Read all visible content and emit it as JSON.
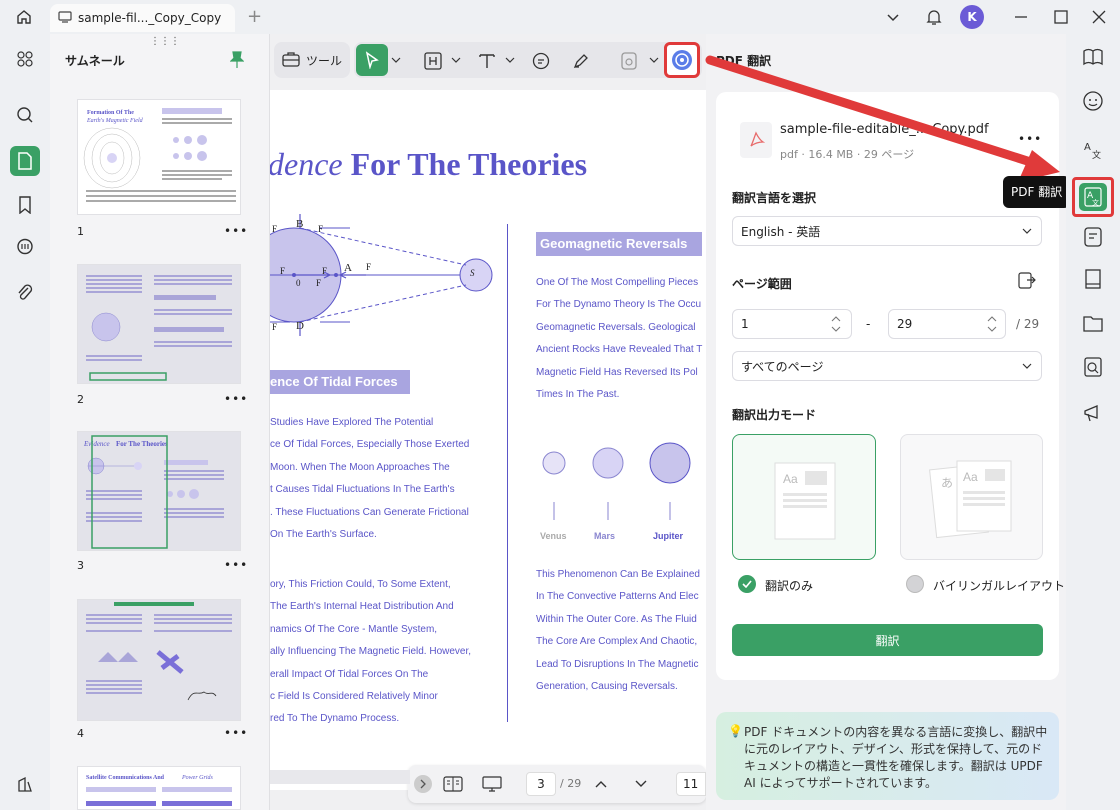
{
  "titlebar": {
    "tab_title": "sample-fil..._Copy_Copy",
    "new_tab": "+",
    "avatar_letter": "K"
  },
  "thumbnails": {
    "title": "サムネール",
    "pages": [
      {
        "num": "1"
      },
      {
        "num": "2"
      },
      {
        "num": "3"
      },
      {
        "num": "4"
      }
    ],
    "more": "•••",
    "thumb1_title_a": "Formation Of The",
    "thumb1_title_b": "Earth's Magnetic Field",
    "thumb3_title_a": "Evidence",
    "thumb3_title_b": "For The Theories",
    "thumb5_title_a": "Satellite Communications And",
    "thumb5_title_b": "Power Grids"
  },
  "toolbar": {
    "tools_label": "ツール"
  },
  "document": {
    "heading_italic": "dence",
    "heading_bold": "For The Theories",
    "section_tidal": "ence Of Tidal Forces",
    "section_geomag": "Geomagnetic Reversals",
    "diagram_labels": {
      "b": "B",
      "d": "D",
      "a": "A",
      "o": "0",
      "ff1": "F",
      "ff2": "F",
      "fg1": "F",
      "fg2": "F",
      "fg3": "F",
      "fc": "F",
      "fr": "F",
      "s": "S"
    },
    "left_para1": [
      "Studies Have Explored The Potential",
      "ce Of Tidal Forces, Especially Those Exerted",
      "Moon. When The Moon Approaches The",
      "t Causes Tidal Fluctuations In The Earth's",
      ". These Fluctuations Can Generate Frictional",
      "On The Earth's Surface."
    ],
    "left_para2": [
      "ory, This Friction Could, To Some Extent,",
      "The Earth's Internal Heat Distribution And",
      "namics Of The Core - Mantle System,",
      "ally Influencing The Magnetic Field. However,",
      "erall Impact Of Tidal Forces On The",
      "c Field Is Considered Relatively Minor",
      "red To The Dynamo Process."
    ],
    "right_para1": [
      "One Of The Most Compelling Pieces",
      "For The Dynamo Theory Is The Occu",
      "Geomagnetic Reversals. Geological",
      "Ancient Rocks Have Revealed That T",
      "Magnetic Field Has Reversed Its Pol",
      "Times In The Past."
    ],
    "planets": [
      "Venus",
      "Mars",
      "Jupiter"
    ],
    "right_para2": [
      "This Phenomenon Can Be Explained",
      "In The Convective Patterns And Elec",
      "Within The Outer Core. As The Fluid",
      "The Core Are Complex And Chaotic,",
      "Lead To Disruptions In The Magnetic",
      "Generation, Causing Reversals."
    ]
  },
  "bottomnav": {
    "current_page": "3",
    "total": "/ 29",
    "zoom": "11"
  },
  "translate_panel": {
    "title": "PDF 翻訳",
    "file_name": "sample-file-editable_... Copy.pdf",
    "file_meta": "pdf · 16.4 MB · 29 ページ",
    "more": "•••",
    "lang_label": "翻訳言語を選択",
    "lang_value": "English - 英語",
    "range_label": "ページ範囲",
    "range_from": "1",
    "range_dash": "-",
    "range_to": "29",
    "range_total": "/ 29",
    "pages_value": "すべてのページ",
    "mode_label": "翻訳出力モード",
    "mode_translate_only": "翻訳のみ",
    "mode_bilingual": "バイリンガルレイアウト",
    "translate_button": "翻訳",
    "info_text": "PDF ドキュメントの内容を異なる言語に変換し、翻訳中に元のレイアウト、デザイン、形式を保持して、元のドキュメントの構造と一貫性を確保します。翻訳は UPDF AI によってサポートされています。"
  },
  "tooltip": "PDF 翻訳",
  "colors": {
    "accent": "#3aa065",
    "doc_blue": "#5a55c8",
    "highlight": "#e03a3a"
  }
}
